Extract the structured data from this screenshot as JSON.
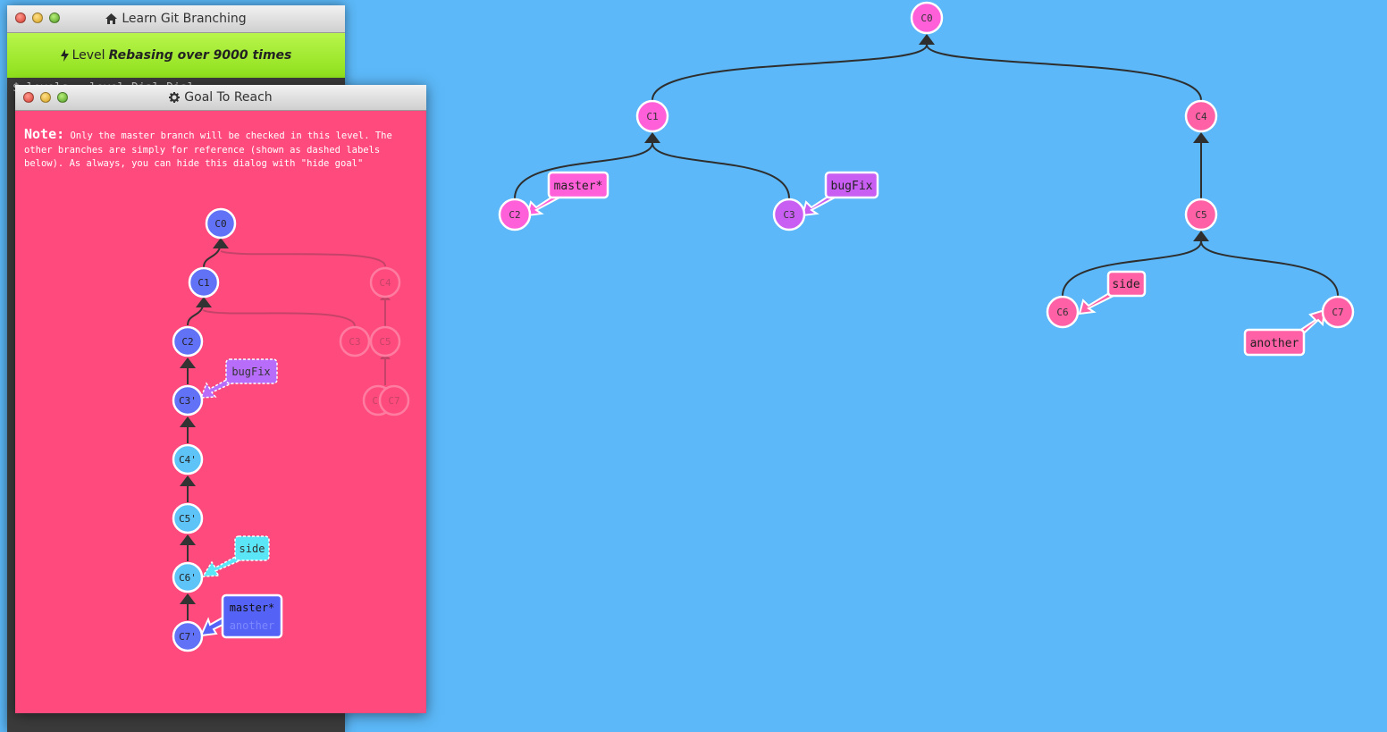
{
  "main_window": {
    "title": "Learn Git Branching",
    "home_icon": "home-icon",
    "level_prefix": "Level",
    "level_name": "Rebasing over 9000 times",
    "level_icon": "lightning-icon",
    "terminal_partial_text": "$ levels --level-Dial-Dial"
  },
  "goal_window": {
    "title": "Goal To Reach",
    "gear_icon": "gear-icon",
    "note_label": "Note:",
    "note_text": " Only the master branch will be checked in this level. The other branches are simply for reference (shown as dashed labels below). As always, you can hide this dialog with \"hide goal\"",
    "nodes": [
      {
        "id": "C0",
        "label": "C0",
        "color": "#6272f6"
      },
      {
        "id": "C1",
        "label": "C1",
        "color": "#6272f6"
      },
      {
        "id": "C2",
        "label": "C2",
        "color": "#6272f6"
      },
      {
        "id": "C3p",
        "label": "C3'",
        "color": "#6272f6"
      },
      {
        "id": "C4p",
        "label": "C4'",
        "color": "#5ec4f8"
      },
      {
        "id": "C5p",
        "label": "C5'",
        "color": "#5ec4f8"
      },
      {
        "id": "C6p",
        "label": "C6'",
        "color": "#5ec4f8"
      },
      {
        "id": "C7p",
        "label": "C7'",
        "color": "#6272f6"
      },
      {
        "id": "gC4",
        "label": "C4",
        "color": "#ff4a7d",
        "faded": true
      },
      {
        "id": "gC3",
        "label": "C3",
        "color": "#ff4a7d",
        "faded": true
      },
      {
        "id": "gC5",
        "label": "C5",
        "color": "#ff4a7d",
        "faded": true
      },
      {
        "id": "gC6",
        "label": "C6",
        "color": "#ff4a7d",
        "faded": true
      },
      {
        "id": "gC7",
        "label": "C7",
        "color": "#ff4a7d",
        "faded": true
      }
    ],
    "branches": [
      {
        "label": "bugFix",
        "color": "#b86dfa",
        "dashed": true
      },
      {
        "label": "side",
        "color": "#5be6f8",
        "dashed": true
      },
      {
        "label": "master*",
        "color": "#5562f6",
        "dashed": false
      },
      {
        "label": "another",
        "color": "#5562f6",
        "dashed": false
      }
    ]
  },
  "tree": {
    "nodes": [
      {
        "id": "C0",
        "label": "C0",
        "color": "#ff5fd8"
      },
      {
        "id": "C1",
        "label": "C1",
        "color": "#ff5fd8"
      },
      {
        "id": "C4",
        "label": "C4",
        "color": "#ff60a6"
      },
      {
        "id": "C2",
        "label": "C2",
        "color": "#ff5fd8"
      },
      {
        "id": "C3",
        "label": "C3",
        "color": "#c95ff2"
      },
      {
        "id": "C5",
        "label": "C5",
        "color": "#ff60a6"
      },
      {
        "id": "C6",
        "label": "C6",
        "color": "#ff60a6"
      },
      {
        "id": "C7",
        "label": "C7",
        "color": "#ff60a6"
      }
    ],
    "branches": [
      {
        "label": "master*",
        "color": "#ff5fd8",
        "target": "C2"
      },
      {
        "label": "bugFix",
        "color": "#c95ff2",
        "target": "C3"
      },
      {
        "label": "side",
        "color": "#ff60a6",
        "target": "C6"
      },
      {
        "label": "another",
        "color": "#ff60a6",
        "target": "C7"
      }
    ]
  }
}
